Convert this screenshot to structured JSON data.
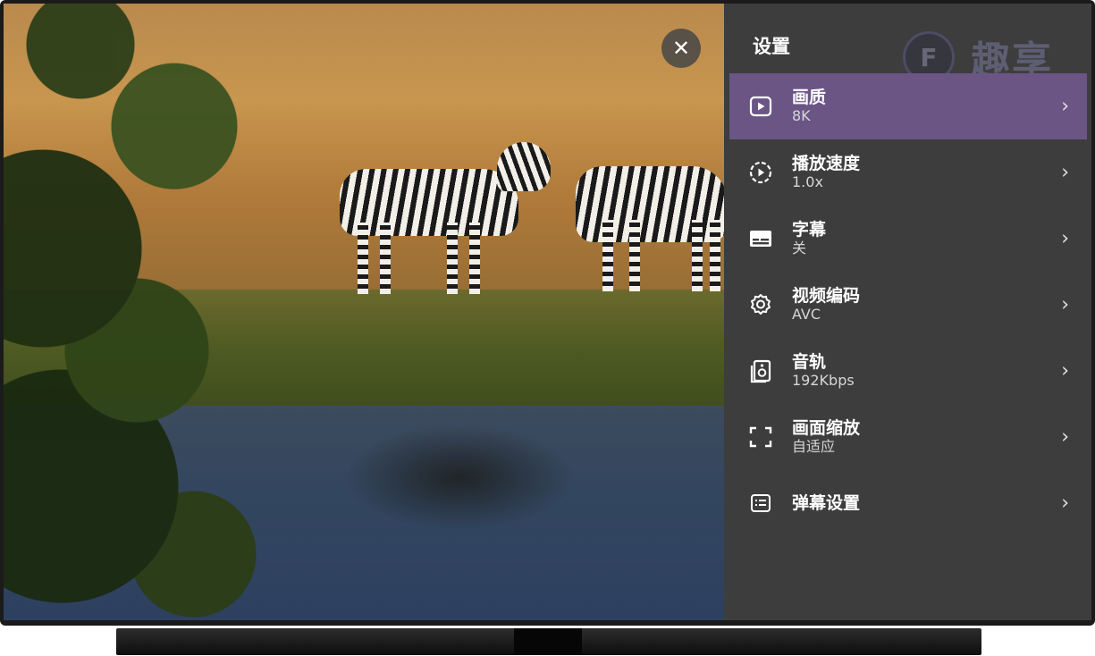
{
  "panel": {
    "title": "设置",
    "watermark": {
      "logo_letter": "F",
      "text": "趣享"
    }
  },
  "close_button": {
    "glyph": "✕"
  },
  "menu": {
    "items": [
      {
        "label": "画质",
        "value": "8K",
        "icon": "play-square-icon",
        "selected": true
      },
      {
        "label": "播放速度",
        "value": "1.0x",
        "icon": "speed-circle-icon",
        "selected": false
      },
      {
        "label": "字幕",
        "value": "关",
        "icon": "subtitles-icon",
        "selected": false
      },
      {
        "label": "视频编码",
        "value": "AVC",
        "icon": "gear-icon",
        "selected": false
      },
      {
        "label": "音轨",
        "value": "192Kbps",
        "icon": "speaker-icon",
        "selected": false
      },
      {
        "label": "画面缩放",
        "value": "自适应",
        "icon": "fullscreen-icon",
        "selected": false
      },
      {
        "label": "弹幕设置",
        "value": "",
        "icon": "danmaku-icon",
        "selected": false
      }
    ],
    "chevron": "›"
  },
  "colors": {
    "panel_bg": "#3d3d3d",
    "selected_bg": "#6a5585",
    "text_primary": "#ffffff",
    "text_secondary": "#d6d6d6"
  }
}
